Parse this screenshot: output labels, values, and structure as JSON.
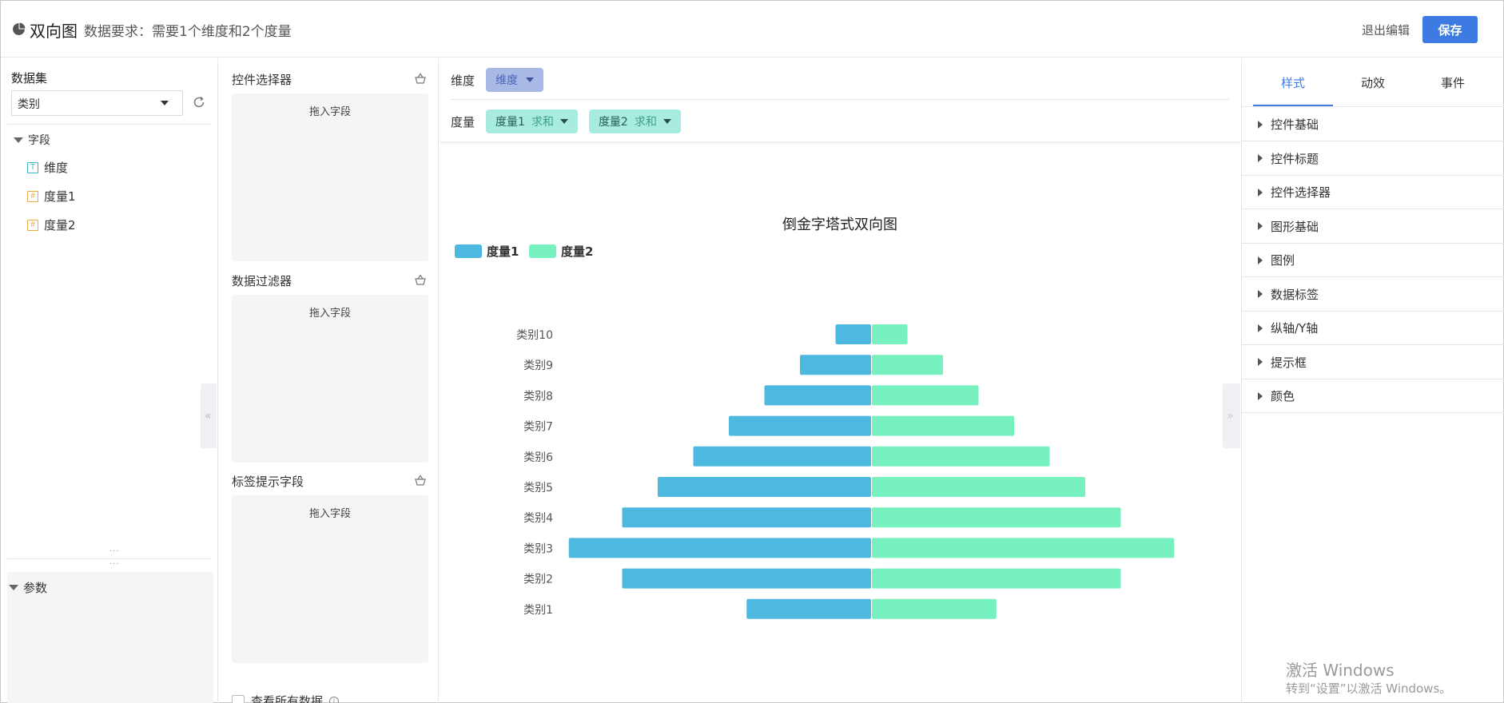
{
  "header": {
    "chart_type": "双向图",
    "requirement": "数据要求：需要1个维度和2个度量",
    "exit_label": "退出编辑",
    "save_label": "保存"
  },
  "dataset": {
    "title": "数据集",
    "selected": "类别",
    "fields_group": "字段",
    "fields": [
      {
        "name": "维度",
        "kind": "T"
      },
      {
        "name": "度量1",
        "kind": "#"
      },
      {
        "name": "度量2",
        "kind": "#"
      }
    ],
    "params_title": "参数"
  },
  "zones": {
    "control_selector": "控件选择器",
    "data_filter": "数据过滤器",
    "tooltip_field": "标签提示字段",
    "drop_hint": "拖入字段",
    "view_all": "查看所有数据"
  },
  "shelf": {
    "dimension_label": "维度",
    "dimension_pill": "维度",
    "measure_label": "度量",
    "measures": [
      {
        "name": "度量1",
        "agg": "求和"
      },
      {
        "name": "度量2",
        "agg": "求和"
      }
    ]
  },
  "right_panel": {
    "tabs": [
      "样式",
      "动效",
      "事件"
    ],
    "active_tab": "样式",
    "sections": [
      "控件基础",
      "控件标题",
      "控件选择器",
      "图形基础",
      "图例",
      "数据标签",
      "纵轴/Y轴",
      "提示框",
      "颜色"
    ]
  },
  "watermark": {
    "line1": "激活 Windows",
    "line2": "转到“设置”以激活 Windows。"
  },
  "colors": {
    "accent": "#3d7be3",
    "series1": "#4db8e0",
    "series2": "#76f1bf"
  },
  "chart_data": {
    "type": "bar",
    "orientation": "horizontal-bidirectional",
    "title": "倒金字塔式双向图",
    "categories": [
      "类别10",
      "类别9",
      "类别8",
      "类别7",
      "类别6",
      "类别5",
      "类别4",
      "类别3",
      "类别2",
      "类别1"
    ],
    "series": [
      {
        "name": "度量1",
        "values": [
          10,
          20,
          30,
          40,
          50,
          60,
          70,
          85,
          70,
          35
        ]
      },
      {
        "name": "度量2",
        "values": [
          10,
          20,
          30,
          40,
          50,
          60,
          70,
          85,
          70,
          35
        ]
      }
    ],
    "legend_position": "top-left",
    "grid": false
  }
}
